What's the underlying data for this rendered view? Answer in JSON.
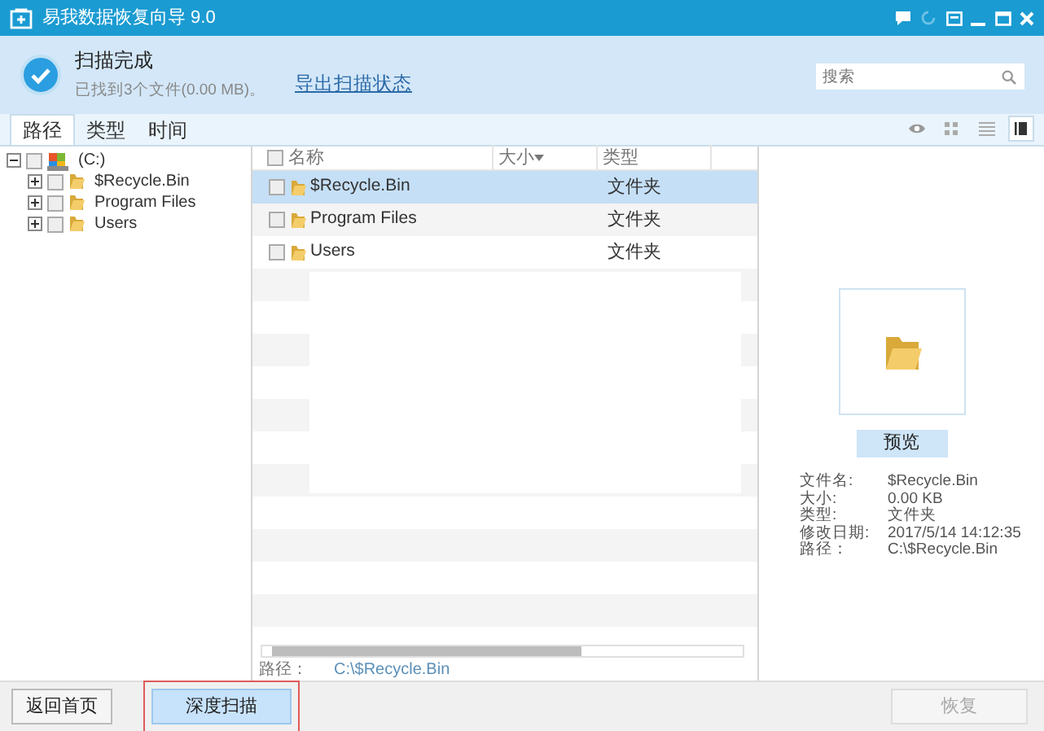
{
  "window": {
    "title": "易我数据恢复向导 9.0"
  },
  "scan_status": {
    "title": "扫描完成",
    "detail": "已找到3个文件(0.00 MB)。",
    "link": "导出扫描状态"
  },
  "search": {
    "placeholder": "搜索"
  },
  "tabs": [
    {
      "label": "路径",
      "selected": true
    },
    {
      "label": "类型",
      "selected": false
    },
    {
      "label": "时间",
      "selected": false
    }
  ],
  "view_modes": [
    {
      "kind": "preview",
      "selected": false
    },
    {
      "kind": "grid",
      "selected": false
    },
    {
      "kind": "list",
      "selected": false
    },
    {
      "kind": "detail",
      "selected": true
    }
  ],
  "tree": {
    "label": "(C:)",
    "checked": false,
    "expanded": true,
    "children": [
      {
        "label": "$Recycle.Bin",
        "checked": false,
        "expanded": false
      },
      {
        "label": "Program Files",
        "checked": false,
        "expanded": false
      },
      {
        "label": "Users",
        "checked": false,
        "expanded": false
      }
    ]
  },
  "table": {
    "all_checked": false,
    "columns": [
      "名称",
      "大小",
      "类型"
    ],
    "rows": [
      {
        "name": "$Recycle.Bin",
        "type": "文件夹",
        "checked": false,
        "selected": true
      },
      {
        "name": "Program Files",
        "type": "文件夹",
        "checked": false,
        "selected": false
      },
      {
        "name": "Users",
        "type": "文件夹",
        "checked": false,
        "selected": false
      }
    ]
  },
  "path_bar": {
    "label": "路径：",
    "value": "C:\\$Recycle.Bin"
  },
  "preview": {
    "button": "预览",
    "details": [
      {
        "label": "文件名:",
        "value": "$Recycle.Bin"
      },
      {
        "label": "大小:",
        "value": "0.00 KB"
      },
      {
        "label": "类型:",
        "value": "文件夹"
      },
      {
        "label": "修改日期:",
        "value": "2017/5/14 14:12:35"
      },
      {
        "label": "路径：",
        "value": "C:\\$Recycle.Bin"
      }
    ]
  },
  "footer": {
    "back": "返回首页",
    "deep_scan": {
      "label": "深度扫描",
      "highlighted": true
    },
    "recover": {
      "label": "恢复",
      "disabled": true
    }
  }
}
